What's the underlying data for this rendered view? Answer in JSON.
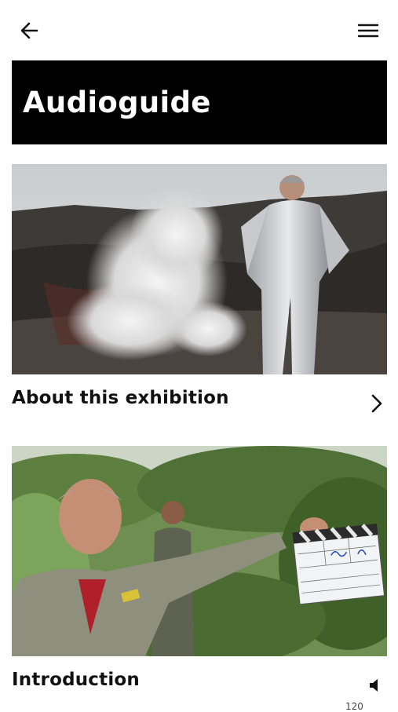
{
  "header": {
    "back_icon": "arrow-left-icon",
    "menu_icon": "hamburger-menu-icon"
  },
  "banner": {
    "title": "Audioguide"
  },
  "cards": [
    {
      "title": "About this exhibition",
      "action_icon": "chevron-right-icon"
    },
    {
      "title": "Introduction",
      "action_icon": "speaker-icon"
    }
  ],
  "footer": {
    "partial_text": "120"
  }
}
